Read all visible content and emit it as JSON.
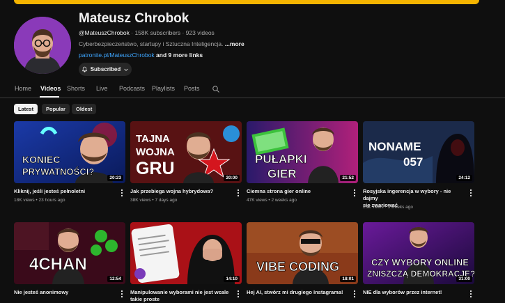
{
  "channel": {
    "name": "Mateusz Chrobok",
    "handle": "@MateuszChrobok",
    "stats": "· 158K subscribers · 923 videos",
    "description": "Cyberbezpieczeństwo, startupy i Sztuczna Inteligencja.",
    "description_more": "...more",
    "link": "patronite.pl/MateuszChrobok",
    "more_links": "and 9 more links",
    "subscribe_label": "Subscribed"
  },
  "tabs": [
    "Home",
    "Videos",
    "Shorts",
    "Live",
    "Podcasts",
    "Playlists",
    "Posts"
  ],
  "active_tab": "Videos",
  "filters": [
    "Latest",
    "Popular",
    "Oldest"
  ],
  "active_filter": "Latest",
  "videos": [
    {
      "title": "Kliknij, jeśli jesteś pełnoletni",
      "title2": "",
      "views": "18K views",
      "age": "23 hours ago",
      "duration": "20:23",
      "thumb_text": [
        "KONIEC",
        "PRYWATNOŚCI?"
      ]
    },
    {
      "title": "Jak przebiega wojna hybrydowa?",
      "title2": "",
      "views": "38K views",
      "age": "7 days ago",
      "duration": "20:00",
      "thumb_text": [
        "TAJNA",
        "WOJNA",
        "GRU"
      ]
    },
    {
      "title": "Ciemna strona gier online",
      "title2": "",
      "views": "47K views",
      "age": "2 weeks ago",
      "duration": "21:52",
      "thumb_text": [
        "PUŁAPKI",
        "GIER"
      ]
    },
    {
      "title": "Rosyjska ingerencja w wybory - nie dajmy",
      "title2": "się zwariować",
      "views": "23K views",
      "age": "3 weeks ago",
      "duration": "24:12",
      "thumb_text": [
        "NONAME",
        "057"
      ]
    },
    {
      "title": "Nie jesteś anonimowy",
      "title2": "",
      "views": "",
      "age": "",
      "duration": "12:54",
      "thumb_text": [
        "4CHAN"
      ]
    },
    {
      "title": "Manipulowanie wyborami nie jest wcale",
      "title2": "takie proste",
      "views": "",
      "age": "",
      "duration": "14:10",
      "thumb_text": []
    },
    {
      "title": "Hej AI, stwórz mi drugiego Instagrama!",
      "title2": "",
      "views": "",
      "age": "",
      "duration": "18:01",
      "thumb_text": [
        "VIBE CODING"
      ]
    },
    {
      "title": "NIE dla wyborów przez internet!",
      "title2": "",
      "views": "",
      "age": "",
      "duration": "31:00",
      "thumb_text": [
        "CZY WYBORY ONLINE",
        "ZNISZCZĄ DEMOKRACJĘ?"
      ]
    }
  ],
  "colors": {
    "background": "#0f0f0f",
    "banner": "#f5b400",
    "link": "#3ea6ff",
    "chip": "#272727",
    "chip_active": "#f1f1f1"
  }
}
